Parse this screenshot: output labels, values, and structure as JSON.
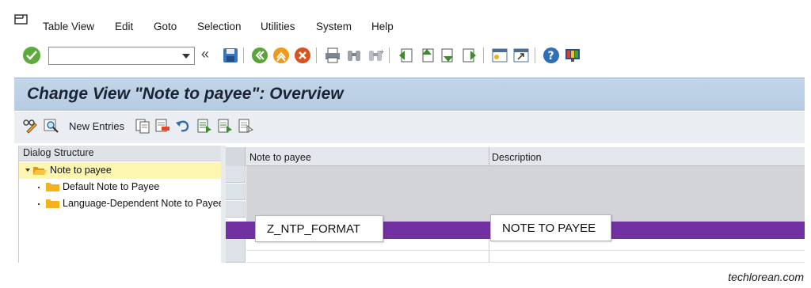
{
  "menubar": {
    "items": [
      "Table View",
      "Edit",
      "Goto",
      "Selection",
      "Utilities",
      "System",
      "Help"
    ]
  },
  "toolbar": {
    "command_value": "",
    "chevron": "«"
  },
  "title": "Change View \"Note to payee\": Overview",
  "app_toolbar": {
    "new_entries_label": "New Entries"
  },
  "dialog_structure": {
    "header": "Dialog Structure",
    "items": [
      {
        "label": "Note to payee",
        "selected": true
      },
      {
        "label": "Default Note to Payee",
        "selected": false
      },
      {
        "label": "Language-Dependent Note to Payee",
        "selected": false
      }
    ]
  },
  "table": {
    "columns": [
      "Note to payee",
      "Description"
    ],
    "highlighted_row": {
      "note": "Z_NTP_FORMAT",
      "description": "NOTE TO PAYEE",
      "color": "#7131a0"
    }
  },
  "colors": {
    "title_band": "#b9cfe5",
    "selected_tree": "#fdf6b0",
    "highlight": "#7131a0",
    "ok_green": "#5eab3b",
    "folder": "#f6b21b"
  },
  "icons": {
    "ok": "checkmark-icon",
    "save": "save-icon",
    "back": "back-icon",
    "exit": "exit-icon",
    "cancel": "cancel-icon",
    "print": "print-icon",
    "find": "find-icon",
    "find_next": "find-next-icon",
    "first_page": "first-page-icon",
    "previous_page": "previous-page-icon",
    "next_page": "next-page-icon",
    "last_page": "last-page-icon",
    "create_session": "create-session-icon",
    "shortcut": "shortcut-icon",
    "help": "help-icon",
    "customize_layout": "customize-layout-icon"
  },
  "watermark": "techlorean.com"
}
